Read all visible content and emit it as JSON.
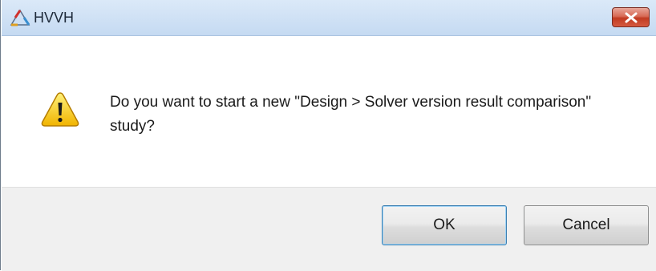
{
  "window": {
    "title": "HVVH",
    "app_icon": "hvvh-triangle-logo-icon",
    "close_icon": "close-x-icon",
    "close_color": "#c13b22"
  },
  "message": {
    "icon": "warning-icon",
    "text": "Do you want to start a new \"Design > Solver version result comparison\" study?"
  },
  "buttons": {
    "ok_label": "OK",
    "cancel_label": "Cancel"
  }
}
